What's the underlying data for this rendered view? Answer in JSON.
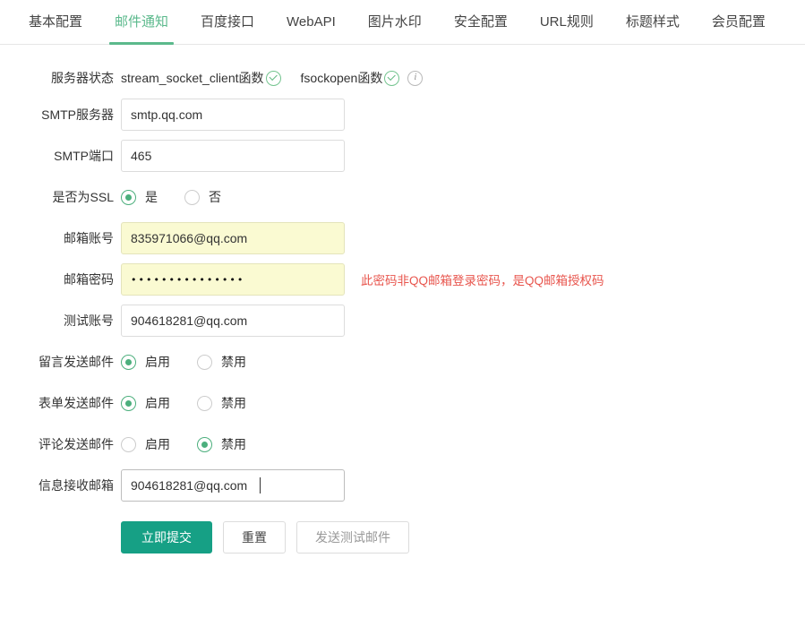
{
  "tabs": [
    {
      "label": "基本配置",
      "active": false
    },
    {
      "label": "邮件通知",
      "active": true
    },
    {
      "label": "百度接口",
      "active": false
    },
    {
      "label": "WebAPI",
      "active": false
    },
    {
      "label": "图片水印",
      "active": false
    },
    {
      "label": "安全配置",
      "active": false
    },
    {
      "label": "URL规则",
      "active": false
    },
    {
      "label": "标题样式",
      "active": false
    },
    {
      "label": "会员配置",
      "active": false
    }
  ],
  "theme": {
    "accent_green": "#5bb98c",
    "primary_button": "#16a085",
    "radio_checked": "#4caf7d",
    "autofill_yellow": "#fafad2",
    "hint_red": "#e8554d"
  },
  "server_status": {
    "label": "服务器状态",
    "items": [
      {
        "text": "stream_socket_client函数",
        "icon": "check-circle-icon"
      },
      {
        "text": "fsockopen函数",
        "icon": "check-circle-icon"
      }
    ],
    "info_icon": "info-circle-icon"
  },
  "fields": {
    "smtp_server": {
      "label": "SMTP服务器",
      "value": "smtp.qq.com",
      "placeholder": ""
    },
    "smtp_port": {
      "label": "SMTP端口",
      "value": "465",
      "placeholder": ""
    },
    "use_ssl": {
      "label": "是否为SSL",
      "options": [
        {
          "label": "是",
          "checked": true
        },
        {
          "label": "否",
          "checked": false
        }
      ]
    },
    "mail_account": {
      "label": "邮箱账号",
      "value": "835971066@qq.com",
      "placeholder": ""
    },
    "mail_password": {
      "label": "邮箱密码",
      "value": "•••••••••••••••",
      "placeholder": "",
      "hint": "此密码非QQ邮箱登录密码，是QQ邮箱授权码"
    },
    "test_account": {
      "label": "测试账号",
      "value": "904618281@qq.com",
      "placeholder": ""
    },
    "message_mail": {
      "label": "留言发送邮件",
      "options": [
        {
          "label": "启用",
          "checked": true
        },
        {
          "label": "禁用",
          "checked": false
        }
      ]
    },
    "form_mail": {
      "label": "表单发送邮件",
      "options": [
        {
          "label": "启用",
          "checked": true
        },
        {
          "label": "禁用",
          "checked": false
        }
      ]
    },
    "comment_mail": {
      "label": "评论发送邮件",
      "options": [
        {
          "label": "启用",
          "checked": false
        },
        {
          "label": "禁用",
          "checked": true
        }
      ]
    },
    "receive_mailbox": {
      "label": "信息接收邮箱",
      "value": "904618281@qq.com",
      "placeholder": ""
    }
  },
  "buttons": {
    "submit": "立即提交",
    "reset": "重置",
    "send_test": "发送测试邮件"
  }
}
